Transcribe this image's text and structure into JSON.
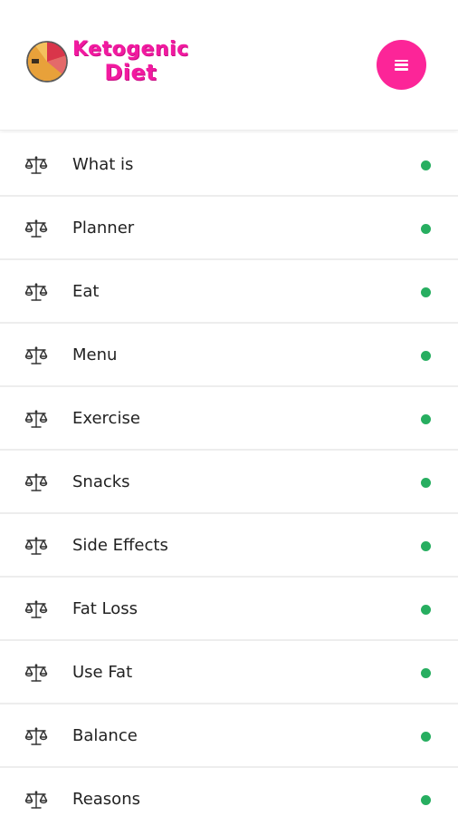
{
  "header": {
    "logo_line1": "Ketogenic",
    "logo_line2": "Diet",
    "logo_icon": "pie-chart-logo",
    "menu_icon": "hamburger-icon"
  },
  "colors": {
    "brand_pink": "#f21aa0",
    "menu_button": "#fc2598",
    "status_dot": "#27ae60",
    "text": "#222222",
    "divider": "#ededed"
  },
  "menu": {
    "item_icon": "balance-scale-icon",
    "items": [
      {
        "label": "What is"
      },
      {
        "label": "Planner"
      },
      {
        "label": "Eat"
      },
      {
        "label": "Menu"
      },
      {
        "label": "Exercise"
      },
      {
        "label": "Snacks"
      },
      {
        "label": "Side Effects"
      },
      {
        "label": "Fat Loss"
      },
      {
        "label": "Use Fat"
      },
      {
        "label": "Balance"
      },
      {
        "label": "Reasons"
      }
    ]
  }
}
